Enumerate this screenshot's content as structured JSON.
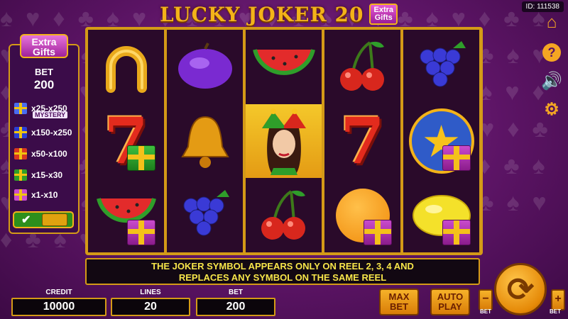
{
  "game_id": "ID: 111538",
  "title": {
    "main": "LUCKY JOKER 20",
    "badge_line1": "Extra",
    "badge_line2": "Gifts"
  },
  "side_icons": [
    "home-icon",
    "help-icon",
    "sound-icon",
    "settings-icon"
  ],
  "left_panel": {
    "logo_line1": "Extra",
    "logo_line2": "Gifts",
    "bet_label": "BET",
    "bet_value": "200",
    "gifts": [
      {
        "range": "x25-x250",
        "extra": "MYSTERY",
        "color": "#4a6cf0"
      },
      {
        "range": "x150-x250",
        "color": "#2a3fd6"
      },
      {
        "range": "x50-x100",
        "color": "#d8371f"
      },
      {
        "range": "x15-x30",
        "color": "#2f9e2a"
      },
      {
        "range": "x1-x10",
        "color": "#c94bcd"
      }
    ]
  },
  "reels": [
    [
      "horseshoe",
      "seven+gift",
      "watermelon+gift"
    ],
    [
      "plum",
      "bell",
      "grapes"
    ],
    [
      "watermelon",
      "joker",
      "cherries"
    ],
    [
      "cherries",
      "seven",
      "orange+gift"
    ],
    [
      "grapes",
      "star+gift",
      "lemon+gift"
    ]
  ],
  "message_line1": "THE JOKER SYMBOL APPEARS ONLY ON REEL 2, 3, 4 AND",
  "message_line2": "REPLACES ANY SYMBOL ON THE SAME REEL",
  "bottom": {
    "credit_label": "CREDIT",
    "credit_value": "10000",
    "lines_label": "LINES",
    "lines_value": "20",
    "bet_label": "BET",
    "bet_value": "200",
    "maxbet_line1": "MAX",
    "maxbet_line2": "BET",
    "autoplay_line1": "AUTO",
    "autoplay_line2": "PLAY",
    "minus_label": "BET",
    "plus_label": "BET"
  }
}
